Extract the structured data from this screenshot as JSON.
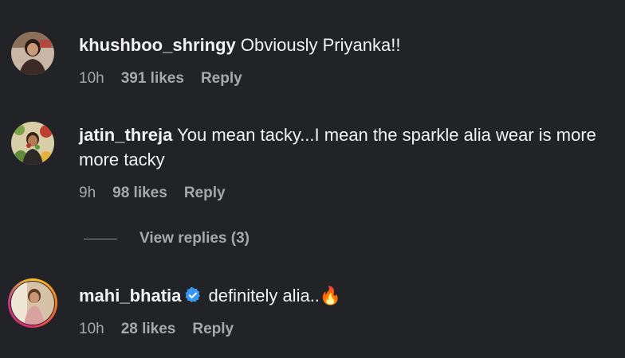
{
  "comments": [
    {
      "username": "khushboo_shringy",
      "text": "Obviously Priyanka!!",
      "time": "10h",
      "likes": "391 likes",
      "reply": "Reply"
    },
    {
      "username": "jatin_threja",
      "text": "You mean tacky...I mean the sparkle alia wear is more more tacky",
      "time": "9h",
      "likes": "98 likes",
      "reply": "Reply"
    },
    {
      "username": "mahi_bhatia",
      "text": "definitely alia..🔥",
      "time": "10h",
      "likes": "28 likes",
      "reply": "Reply",
      "verified": true
    }
  ],
  "view_replies": "View replies (3)",
  "colors": {
    "background": "#222326",
    "text": "#f2f2f2",
    "muted": "#a7a8ab",
    "verified": "#3897f0"
  }
}
